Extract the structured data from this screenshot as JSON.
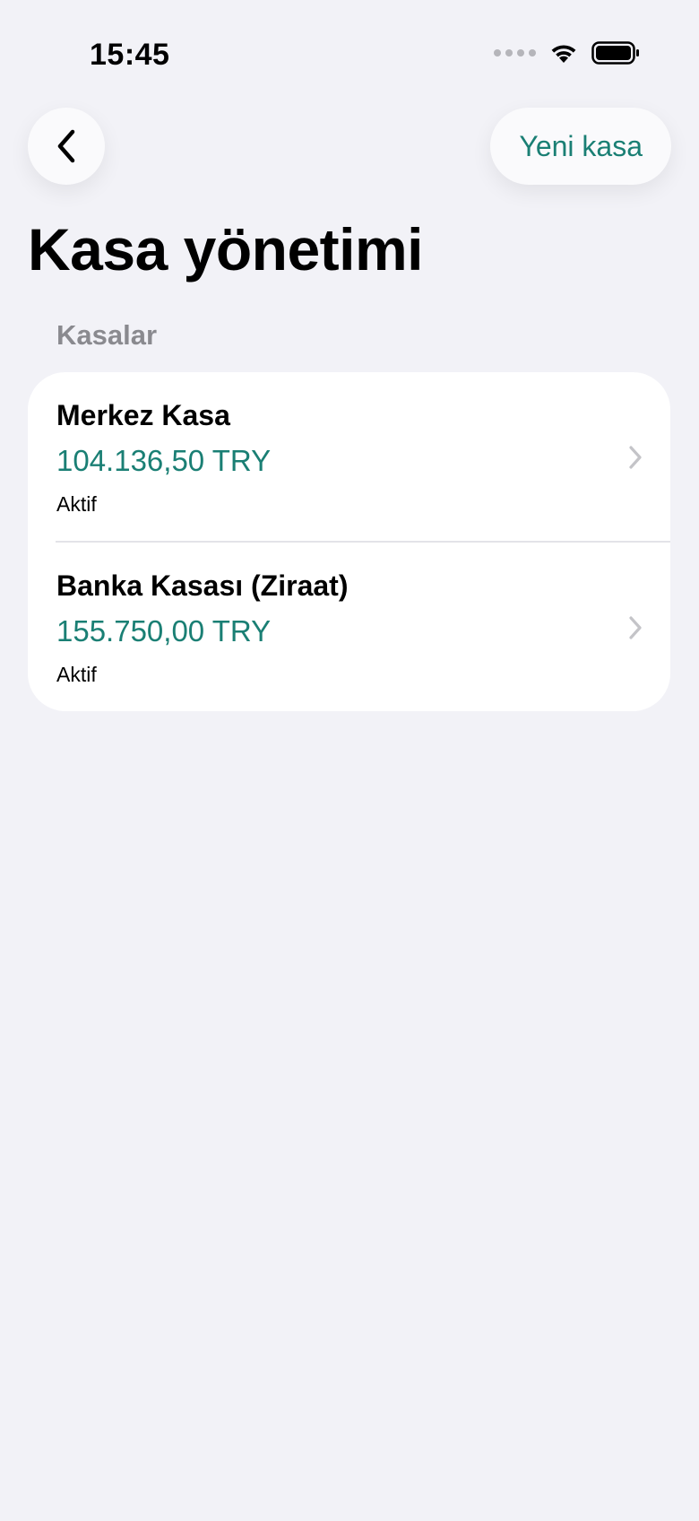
{
  "status_bar": {
    "time": "15:45"
  },
  "nav": {
    "new_label": "Yeni kasa"
  },
  "title": "Kasa yönetimi",
  "section": {
    "header": "Kasalar"
  },
  "kasalar": [
    {
      "name": "Merkez Kasa",
      "amount": "104.136,50 TRY",
      "status": "Aktif"
    },
    {
      "name": "Banka Kasası (Ziraat)",
      "amount": "155.750,00 TRY",
      "status": "Aktif"
    }
  ],
  "colors": {
    "accent": "#1a7f74",
    "background": "#f2f2f7",
    "card": "#ffffff",
    "secondary_text": "#8a8a8f"
  },
  "icons": {
    "back": "chevron-left-icon",
    "row": "chevron-right-icon",
    "wifi": "wifi-icon",
    "battery": "battery-icon",
    "signal": "cellular-signal-icon"
  }
}
